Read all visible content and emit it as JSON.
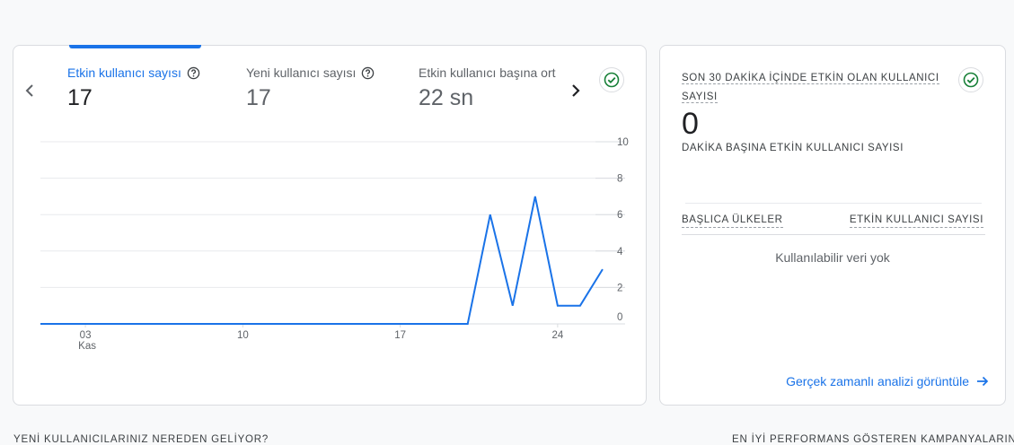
{
  "overview": {
    "metrics": [
      {
        "label": "Etkin kullanıcı sayısı",
        "value": "17"
      },
      {
        "label": "Yeni kullanıcı sayısı",
        "value": "17"
      },
      {
        "label": "Etkin kullanıcı başına ort",
        "value": "22 sn"
      }
    ],
    "accent_color": "#1a73e8"
  },
  "chart_data": {
    "type": "line",
    "x": [
      1,
      2,
      3,
      4,
      5,
      6,
      7,
      8,
      9,
      10,
      11,
      12,
      13,
      14,
      15,
      16,
      17,
      18,
      19,
      20,
      21,
      22,
      23,
      24,
      25,
      26,
      27
    ],
    "series": [
      {
        "values": [
          0,
          0,
          0,
          0,
          0,
          0,
          0,
          0,
          0,
          0,
          0,
          0,
          0,
          0,
          0,
          0,
          0,
          0,
          0,
          0,
          6,
          1,
          7,
          1,
          1,
          3
        ]
      }
    ],
    "x_ticks": [
      {
        "x": 3,
        "label": "03",
        "sublabel": "Kas"
      },
      {
        "x": 10,
        "label": "10"
      },
      {
        "x": 17,
        "label": "17"
      },
      {
        "x": 24,
        "label": "24"
      }
    ],
    "y_ticks": [
      0,
      2,
      4,
      6,
      8,
      10
    ],
    "ylim": [
      0,
      10
    ],
    "xlim": [
      1,
      27
    ],
    "grid": true,
    "y_axis_position": "right",
    "line_color": "#1a73e8"
  },
  "realtime": {
    "title": "SON 30 DAKİKA İÇİNDE ETKİN OLAN KULLANICI SAYISI",
    "value": "0",
    "subtitle": "DAKİKA BAŞINA ETKİN KULLANICI SAYISI",
    "col_left": "BAŞLICA ÜLKELER",
    "col_right": "ETKİN KULLANICI SAYISI",
    "empty_text": "Kullanılabilir veri yok",
    "link_label": "Gerçek zamanlı analizi görüntüle"
  },
  "sections": {
    "left_heading": "YENİ KULLANICILARINIZ NEREDEN GELİYOR?",
    "right_heading": "EN İYİ PERFORMANS GÖSTEREN KAMPANYALARINIZ"
  }
}
